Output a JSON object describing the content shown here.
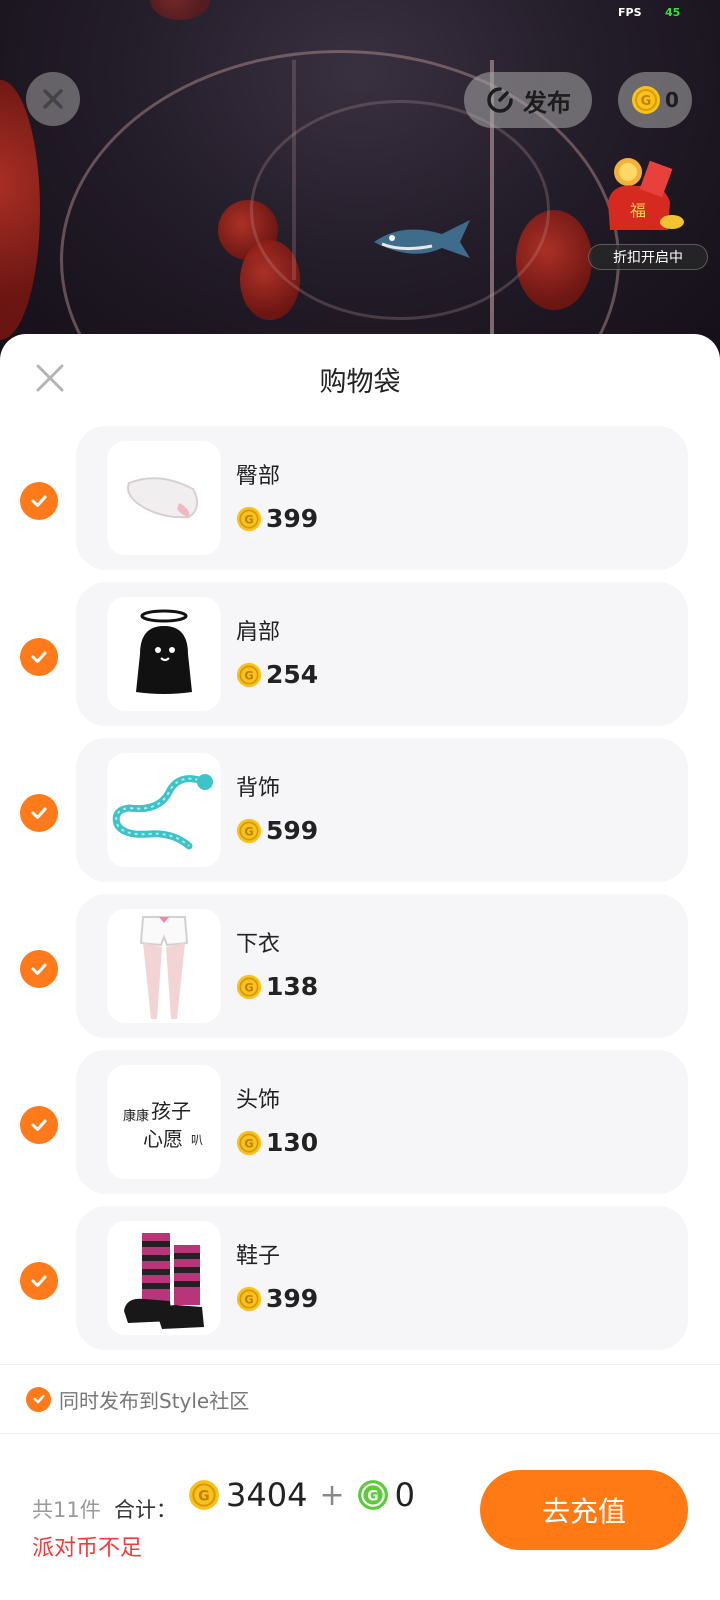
{
  "status": {
    "fps_label": "FPS",
    "fps_value": "45"
  },
  "top_bar": {
    "publish_label": "发布",
    "coin_balance": "0",
    "discount_label": "折扣开启中"
  },
  "sheet": {
    "title": "购物袋",
    "items": [
      {
        "name": "臀部",
        "price": "399",
        "checked": true,
        "icon": "fluffy-tail-icon"
      },
      {
        "name": "肩部",
        "price": "254",
        "checked": true,
        "icon": "ghost-halo-icon"
      },
      {
        "name": "背饰",
        "price": "599",
        "checked": true,
        "icon": "ice-dragon-icon"
      },
      {
        "name": "下衣",
        "price": "138",
        "checked": true,
        "icon": "white-shorts-icon"
      },
      {
        "name": "头饰",
        "price": "130",
        "checked": true,
        "icon": "text-sticker-icon",
        "sticker_text": [
          "康康",
          "孩子",
          "心愿",
          "叭"
        ]
      },
      {
        "name": "鞋子",
        "price": "399",
        "checked": true,
        "icon": "striped-boots-icon"
      }
    ],
    "publish_option": {
      "label": "同时发布到Style社区",
      "checked": true
    }
  },
  "footer": {
    "count": "共11件",
    "total_label": "合计：",
    "gold_total": "3404",
    "plus": "+",
    "green_total": "0",
    "warning": "派对币不足",
    "recharge_label": "去充值"
  },
  "colors": {
    "accent": "#ff7a14",
    "warning": "#f23c3c",
    "gold": "#f7c21c",
    "green": "#5ccb3a"
  }
}
